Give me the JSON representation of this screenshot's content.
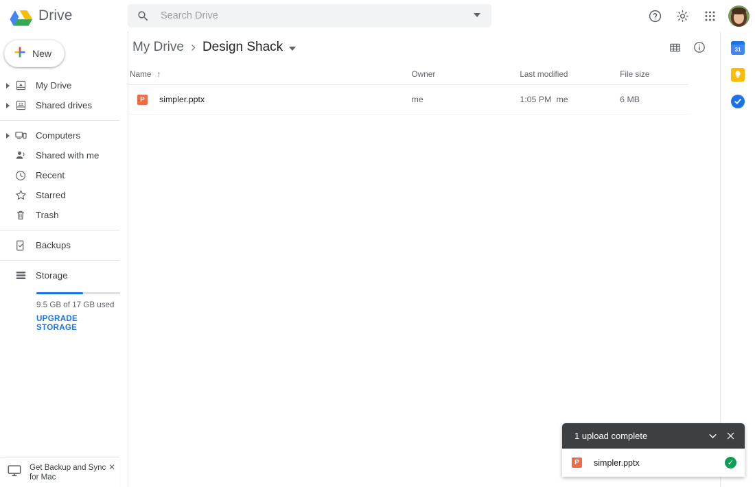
{
  "app": {
    "brand": "Drive",
    "logo_icon": "drive-logo-icon"
  },
  "search": {
    "placeholder": "Search Drive",
    "value": "",
    "icon": "search-icon",
    "options_icon": "search-options-caret-icon"
  },
  "topbar": {
    "help_icon": "help-icon",
    "settings_icon": "gear-icon",
    "apps_icon": "apps-grid-icon",
    "avatar_icon": "avatar"
  },
  "sidebar": {
    "new_button": {
      "label": "New",
      "icon": "plus-icon"
    },
    "items": [
      {
        "label": "My Drive",
        "icon": "my-drive-icon",
        "expandable": true
      },
      {
        "label": "Shared drives",
        "icon": "shared-drives-icon",
        "expandable": true
      },
      {
        "label": "Computers",
        "icon": "computers-icon",
        "expandable": true
      },
      {
        "label": "Shared with me",
        "icon": "shared-with-me-icon",
        "expandable": false
      },
      {
        "label": "Recent",
        "icon": "clock-icon",
        "expandable": false
      },
      {
        "label": "Starred",
        "icon": "star-icon",
        "expandable": false
      },
      {
        "label": "Trash",
        "icon": "trash-icon",
        "expandable": false
      },
      {
        "label": "Backups",
        "icon": "backups-icon",
        "expandable": false
      },
      {
        "label": "Storage",
        "icon": "storage-icon",
        "expandable": false
      }
    ],
    "storage": {
      "used_text": "9.5 GB of 17 GB used",
      "upgrade_label": "UPGRADE STORAGE",
      "percent": 56,
      "fill_color": "#1a73e8"
    }
  },
  "banner": {
    "text": "Get Backup and Sync for Mac",
    "icon": "monitor-icon",
    "close_icon": "close-icon"
  },
  "breadcrumb": {
    "root": "My Drive",
    "separator": "›",
    "current": "Design Shack",
    "caret_icon": "chevron-down-icon",
    "grid_view_icon": "grid-view-icon",
    "details_icon": "info-icon"
  },
  "table": {
    "columns": [
      "Name",
      "Owner",
      "Last modified",
      "File size"
    ],
    "sort_icon": "↑",
    "rows": [
      {
        "name": "simpler.pptx",
        "file_icon": "powerpoint-icon",
        "file_icon_letter": "P",
        "file_icon_color": "#ed6c47",
        "owner": "me",
        "modified_time": "1:05 PM",
        "modified_by": "me",
        "size": "6 MB"
      }
    ]
  },
  "rail": {
    "items": [
      {
        "name": "google-calendar-icon",
        "label": "31"
      },
      {
        "name": "google-keep-icon",
        "label": ""
      },
      {
        "name": "google-tasks-icon",
        "label": ""
      }
    ]
  },
  "toast": {
    "title": "1 upload complete",
    "collapse_icon": "chevron-down-icon",
    "close_icon": "close-icon",
    "file_name": "simpler.pptx",
    "file_icon_letter": "P",
    "status_icon": "check-circle-icon",
    "status_color": "#0f9d58"
  }
}
